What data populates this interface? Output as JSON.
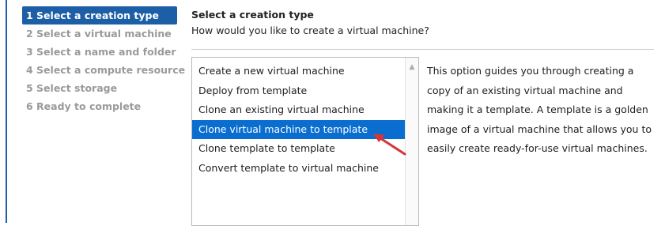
{
  "wizard": {
    "steps": [
      {
        "label": "1 Select a creation type",
        "active": true
      },
      {
        "label": "2 Select a virtual machine",
        "active": false
      },
      {
        "label": "3 Select a name and folder",
        "active": false
      },
      {
        "label": "4 Select a compute resource",
        "active": false
      },
      {
        "label": "5 Select storage",
        "active": false
      },
      {
        "label": "6 Ready to complete",
        "active": false
      }
    ]
  },
  "main": {
    "title": "Select a creation type",
    "subtitle": "How would you like to create a virtual machine?",
    "options": [
      {
        "label": "Create a new virtual machine",
        "selected": false
      },
      {
        "label": "Deploy from template",
        "selected": false
      },
      {
        "label": "Clone an existing virtual machine",
        "selected": false
      },
      {
        "label": "Clone virtual machine to template",
        "selected": true
      },
      {
        "label": "Clone template to template",
        "selected": false
      },
      {
        "label": "Convert template to virtual machine",
        "selected": false
      }
    ],
    "description_lines": [
      "This option guides you through creating a",
      "copy of an existing virtual machine and",
      "making it a template. A template is a golden",
      "image of a virtual machine that allows you to",
      "easily create ready-for-use virtual machines."
    ]
  },
  "colors": {
    "active_step_bg": "#1c5fa6",
    "selected_option_bg": "#0a6ed1",
    "annotation_arrow": "#d6343b"
  },
  "icons": {
    "scroll_up": "chevron-up-icon",
    "annotation": "red-arrow-icon"
  }
}
